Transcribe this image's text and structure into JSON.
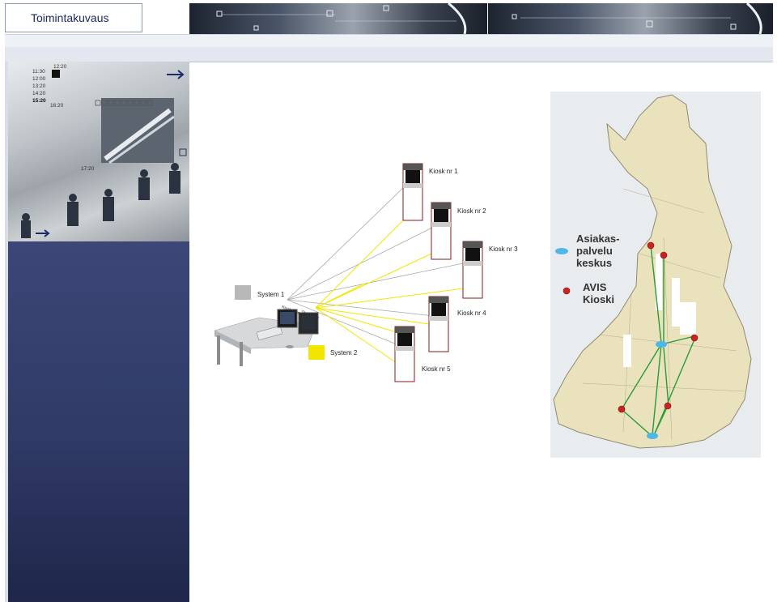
{
  "header": {
    "title": "Toimintakuvaus"
  },
  "side_photo": {
    "times": [
      "12:20",
      "11:30",
      "12:00",
      "13:20",
      "14:20",
      "15:20",
      "16:20",
      "17:20"
    ]
  },
  "diagram": {
    "systems": [
      {
        "label": "System 1",
        "color": "#b8b8b8"
      },
      {
        "label": "System 2",
        "color": "#f2e600"
      }
    ],
    "kiosks": [
      "Kiosk nr 1",
      "Kiosk nr 2",
      "Kiosk nr 3",
      "Kiosk nr 4",
      "Kiosk nr 5"
    ]
  },
  "map": {
    "legend": [
      {
        "label_line1": "Asiakas-",
        "label_line2": "palvelu",
        "label_line3": "keskus",
        "color": "#4fb6e8"
      },
      {
        "label_line1": "AVIS",
        "label_line2": "Kioski",
        "label_line3": "",
        "color": "#cc2222"
      }
    ]
  }
}
